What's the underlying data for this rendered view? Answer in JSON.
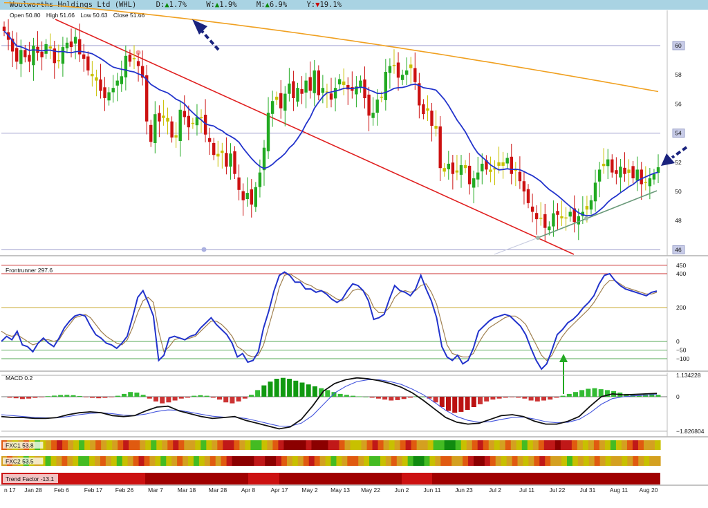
{
  "header": {
    "title": "Woolworths Holdings Ltd (WHL)",
    "changes": [
      {
        "label": "D:",
        "dir": "up",
        "value": "1.7%",
        "color": "#0a8a0a"
      },
      {
        "label": "W:",
        "dir": "up",
        "value": "1.9%",
        "color": "#0a8a0a"
      },
      {
        "label": "M:",
        "dir": "up",
        "value": "6.9%",
        "color": "#0a8a0a"
      },
      {
        "label": "Y:",
        "dir": "down",
        "value": "19.1%",
        "color": "#cc0000"
      }
    ]
  },
  "ohlc": {
    "open": "Open 50.80",
    "high": "High 51.66",
    "low": "Low 50.63",
    "close": "Close 51.66"
  },
  "panels": {
    "frontrunner_label": "Frontrunner 297.6",
    "macd_label": "MACD 0.2",
    "fxc1_label": "FXC1 53.8",
    "fxc2_label": "FXC2 53.5",
    "trend_label": "Trend Factor -13.1"
  },
  "colors": {
    "up_candle": "#22aa22",
    "down_candle": "#cc1111",
    "neutral_candle": "#c8c000",
    "ma_short": "#2233cc",
    "ma_long": "#f0a020",
    "trendline": "#e02020",
    "support": "#6a9a7a"
  },
  "chart_data": [
    {
      "type": "candlestick",
      "name": "price",
      "yticks": [
        46,
        48,
        50,
        52,
        54,
        56,
        58,
        60
      ],
      "ylim": [
        45.6,
        62.8
      ],
      "grid": "horizontal lines at 46, 54, 60",
      "close_series": [
        61.0,
        60.4,
        59.6,
        58.9,
        59.7,
        59.2,
        58.9,
        60.0,
        59.5,
        59.2,
        60.1,
        59.8,
        58.8,
        59.0,
        59.9,
        60.2,
        59.9,
        60.6,
        59.4,
        59.1,
        58.3,
        57.9,
        57.6,
        56.9,
        56.4,
        56.8,
        57.1,
        57.6,
        57.9,
        59.3,
        58.9,
        59.1,
        58.6,
        57.8,
        54.8,
        53.4,
        55.3,
        54.8,
        55.2,
        54.8,
        53.7,
        53.7,
        55.6,
        55.1,
        54.4,
        54.7,
        55.1,
        55.1,
        53.9,
        53.4,
        52.5,
        52.4,
        52.8,
        51.7,
        52.6,
        51.2,
        50.1,
        49.4,
        49.9,
        49.1,
        50.3,
        51.3,
        53.0,
        55.4,
        56.2,
        56.5,
        55.7,
        56.7,
        57.4,
        56.4,
        57.1,
        56.7,
        57.6,
        56.9,
        58.3,
        56.6,
        57.1,
        56.8,
        56.3,
        57.1,
        57.7,
        57.3,
        57.0,
        56.9,
        57.2,
        57.6,
        56.4,
        55.2,
        55.4,
        56.3,
        56.5,
        58.2,
        58.6,
        58.6,
        57.8,
        58.0,
        58.3,
        58.7,
        57.5,
        55.9,
        55.3,
        55.7,
        54.5,
        54.3,
        51.6,
        51.6,
        51.9,
        51.2,
        51.3,
        51.8,
        51.6,
        50.5,
        50.9,
        51.3,
        51.9,
        51.5,
        51.5,
        51.6,
        52.0,
        52.0,
        52.3,
        51.2,
        51.5,
        50.7,
        50.0,
        49.2,
        48.6,
        48.1,
        48.2,
        47.5,
        47.6,
        48.5,
        48.4,
        48.3,
        48.2,
        48.6,
        47.9,
        48.3,
        48.6,
        49.0,
        49.4,
        50.6,
        51.5,
        51.9,
        52.2,
        51.3,
        51.2,
        51.7,
        51.2,
        51.5,
        50.9,
        51.5,
        50.5,
        50.6,
        50.9,
        51.2,
        51.66
      ],
      "ma_short_endpoints": [
        {
          "label": "start",
          "value": 62.0
        },
        {
          "label": "end",
          "value": 50.4
        }
      ],
      "ma_long_endpoints": [
        {
          "label": "start",
          "value": 63.0
        },
        {
          "label": "end",
          "value": 56.6
        }
      ],
      "trendline_endpoints": [
        {
          "label": "start",
          "value": 62.2
        },
        {
          "label": "end",
          "value": 45.8
        }
      ],
      "support_endpoints": [
        {
          "label": "Jul 11",
          "value": 46.8
        },
        {
          "label": "Aug 20",
          "value": 50.1
        }
      ]
    },
    {
      "type": "line",
      "name": "Frontrunner",
      "yticks": [
        -100,
        -50,
        0,
        200,
        400,
        450
      ],
      "ylim": [
        -170,
        510
      ],
      "series": [
        {
          "color": "#2233cc",
          "values": [
            0,
            30,
            10,
            60,
            -20,
            -30,
            -60,
            -10,
            20,
            -10,
            -30,
            20,
            80,
            120,
            150,
            160,
            150,
            90,
            40,
            20,
            -10,
            -20,
            -40,
            -10,
            30,
            140,
            260,
            300,
            230,
            150,
            -110,
            -80,
            20,
            30,
            20,
            10,
            30,
            40,
            80,
            110,
            140,
            100,
            70,
            40,
            -10,
            -90,
            -70,
            -120,
            -110,
            -60,
            80,
            180,
            300,
            390,
            410,
            390,
            350,
            350,
            310,
            310,
            290,
            300,
            280,
            250,
            230,
            250,
            300,
            340,
            330,
            300,
            240,
            130,
            140,
            160,
            250,
            330,
            300,
            290,
            270,
            310,
            390,
            310,
            240,
            140,
            -30,
            -90,
            -110,
            -80,
            -130,
            -110,
            -40,
            60,
            90,
            120,
            140,
            150,
            160,
            150,
            120,
            90,
            40,
            -40,
            -110,
            -160,
            -130,
            -50,
            40,
            70,
            110,
            130,
            160,
            200,
            230,
            270,
            340,
            390,
            400,
            360,
            330,
            310,
            300,
            290,
            280,
            270,
            290,
            297.6
          ]
        },
        {
          "color": "#a08050",
          "values": [
            60,
            40,
            30,
            40,
            20,
            0,
            -20,
            -10,
            10,
            10,
            0,
            10,
            60,
            100,
            140,
            150,
            160,
            140,
            100,
            60,
            30,
            10,
            -10,
            -20,
            10,
            80,
            170,
            240,
            260,
            230,
            60,
            -60,
            -30,
            10,
            20,
            10,
            20,
            30,
            60,
            90,
            120,
            120,
            100,
            70,
            30,
            -30,
            -50,
            -80,
            -90,
            -80,
            -20,
            90,
            200,
            320,
            390,
            400,
            380,
            360,
            340,
            330,
            310,
            300,
            290,
            270,
            250,
            240,
            260,
            300,
            310,
            300,
            270,
            200,
            170,
            170,
            200,
            260,
            290,
            300,
            290,
            300,
            330,
            340,
            290,
            220,
            100,
            -20,
            -70,
            -80,
            -90,
            -90,
            -70,
            -10,
            40,
            80,
            100,
            120,
            140,
            150,
            150,
            130,
            100,
            40,
            -20,
            -80,
            -110,
            -80,
            -20,
            30,
            70,
            100,
            130,
            160,
            190,
            230,
            280,
            330,
            360,
            360,
            340,
            320,
            310,
            300,
            290,
            280,
            280,
            290
          ]
        }
      ],
      "hlines": [
        450,
        400,
        200,
        0,
        -50,
        -100
      ]
    },
    {
      "type": "line",
      "name": "MACD",
      "yticks": [
        -1.826804,
        0,
        1.134228
      ],
      "ylim": [
        -1.9,
        1.2
      ],
      "histogram": [
        -0.05,
        -0.08,
        -0.12,
        -0.1,
        -0.06,
        -0.02,
        0.03,
        0.06,
        0.09,
        0.1,
        0.08,
        0.04,
        -0.02,
        -0.06,
        -0.08,
        -0.06,
        -0.03,
        0.05,
        0.15,
        0.25,
        0.22,
        0.1,
        -0.1,
        -0.25,
        -0.35,
        -0.3,
        -0.2,
        -0.1,
        -0.05,
        0.05,
        0.08,
        0.05,
        -0.05,
        -0.15,
        -0.3,
        -0.35,
        -0.25,
        -0.1,
        0.1,
        0.35,
        0.6,
        0.8,
        0.95,
        1.0,
        0.95,
        0.85,
        0.75,
        0.65,
        0.55,
        0.45,
        0.35,
        0.25,
        0.15,
        0.1,
        0.05,
        0.02,
        0.0,
        -0.05,
        -0.1,
        -0.15,
        -0.2,
        -0.18,
        -0.12,
        -0.05,
        0.02,
        0.0,
        -0.1,
        -0.3,
        -0.55,
        -0.75,
        -0.85,
        -0.8,
        -0.7,
        -0.55,
        -0.4,
        -0.25,
        -0.15,
        -0.1,
        -0.05,
        -0.02,
        -0.05,
        -0.1,
        -0.2,
        -0.25,
        -0.2,
        -0.15,
        -0.05,
        0.05,
        0.15,
        0.25,
        0.35,
        0.42,
        0.45,
        0.4,
        0.35,
        0.3,
        0.22,
        0.15,
        0.1,
        0.08,
        0.12,
        0.15,
        0.1
      ],
      "macd_line": [
        -1.05,
        -1.1,
        -1.1,
        -1.15,
        -1.15,
        -1.1,
        -0.95,
        -0.85,
        -0.8,
        -0.85,
        -1.0,
        -1.05,
        -1.0,
        -0.75,
        -0.55,
        -0.5,
        -0.75,
        -0.9,
        -1.05,
        -1.15,
        -1.1,
        -1.05,
        -1.25,
        -1.4,
        -1.55,
        -1.7,
        -1.6,
        -1.2,
        -0.5,
        0.3,
        0.7,
        0.9,
        1.0,
        0.95,
        0.85,
        0.7,
        0.5,
        0.2,
        -0.2,
        -0.65,
        -1.1,
        -1.35,
        -1.45,
        -1.4,
        -1.2,
        -1.0,
        -0.95,
        -1.05,
        -1.3,
        -1.45,
        -1.45,
        -1.3,
        -1.05,
        -0.5,
        0.0,
        0.15,
        0.1,
        0.12,
        0.15,
        0.18
      ],
      "signal_line": [
        -0.95,
        -1.0,
        -1.05,
        -1.1,
        -1.12,
        -1.12,
        -1.05,
        -0.95,
        -0.88,
        -0.85,
        -0.9,
        -0.97,
        -1.0,
        -0.92,
        -0.78,
        -0.7,
        -0.72,
        -0.82,
        -0.93,
        -1.03,
        -1.08,
        -1.08,
        -1.15,
        -1.28,
        -1.42,
        -1.55,
        -1.56,
        -1.4,
        -1.0,
        -0.4,
        0.2,
        0.55,
        0.8,
        0.9,
        0.9,
        0.8,
        0.65,
        0.4,
        0.1,
        -0.3,
        -0.72,
        -1.05,
        -1.25,
        -1.35,
        -1.32,
        -1.2,
        -1.1,
        -1.08,
        -1.18,
        -1.32,
        -1.38,
        -1.35,
        -1.2,
        -0.85,
        -0.4,
        -0.1,
        0.0,
        0.05,
        0.08,
        0.12
      ]
    },
    {
      "type": "heatmap",
      "name": "FXC1",
      "cells": [
        2,
        3,
        4,
        3,
        2,
        4,
        5,
        4,
        3,
        2,
        1,
        2,
        3,
        4,
        5,
        4,
        3,
        2,
        3,
        4,
        3,
        2,
        1,
        2,
        2,
        3,
        4,
        5,
        4,
        3,
        2,
        1,
        2,
        3,
        3,
        4,
        5,
        4,
        3,
        2,
        1,
        1,
        2,
        3,
        4,
        5,
        5,
        4,
        3,
        2,
        1,
        0,
        0,
        0,
        0,
        1,
        0,
        0,
        0,
        1,
        1,
        2,
        3,
        4,
        4,
        3,
        2,
        1,
        2,
        3,
        4,
        3,
        2,
        1,
        2,
        3,
        3,
        4,
        5,
        5,
        6,
        6,
        5,
        4,
        3,
        2,
        1,
        2,
        3,
        4,
        3,
        2,
        3,
        4,
        5,
        4,
        3,
        2,
        1,
        1,
        0,
        1,
        1,
        2,
        3,
        4,
        3,
        2,
        3,
        4,
        5,
        4,
        3,
        2,
        1,
        2,
        3,
        3,
        4
      ]
    },
    {
      "type": "heatmap",
      "name": "FXC2",
      "cells": [
        3,
        2,
        3,
        4,
        5,
        4,
        3,
        4,
        5,
        4,
        3,
        2,
        3,
        4,
        5,
        5,
        4,
        3,
        2,
        3,
        4,
        5,
        4,
        3,
        2,
        1,
        2,
        3,
        4,
        5,
        4,
        3,
        2,
        3,
        4,
        5,
        4,
        3,
        2,
        3,
        2,
        1,
        0,
        0,
        0,
        0,
        1,
        1,
        0,
        0,
        1,
        2,
        3,
        4,
        3,
        2,
        1,
        2,
        3,
        4,
        5,
        4,
        3,
        2,
        2,
        3,
        4,
        5,
        5,
        4,
        3,
        2,
        3,
        4,
        5,
        6,
        6,
        5,
        4,
        3,
        2,
        2,
        3,
        3,
        2,
        1,
        0,
        0,
        1,
        2,
        3,
        4,
        3,
        2,
        3,
        4,
        3,
        2,
        1,
        2,
        3,
        3,
        4,
        5,
        4,
        3,
        4,
        3,
        2,
        3,
        4,
        3,
        3,
        4,
        3,
        2,
        3,
        4,
        3,
        3
      ]
    },
    {
      "type": "heatmap",
      "name": "Trend Factor",
      "segments": [
        {
          "from": "Jan 17",
          "to": "Feb 26",
          "level": "red"
        },
        {
          "from": "Mar 7",
          "to": "Apr 8",
          "level": "dark-red"
        },
        {
          "from": "Apr 8",
          "to": "Apr 17",
          "level": "red"
        },
        {
          "from": "Apr 17",
          "to": "May 2",
          "level": "dark-red"
        },
        {
          "from": "May 2",
          "to": "Jun 2",
          "level": "dark-red"
        },
        {
          "from": "Jun 2",
          "to": "Jun 11",
          "level": "red"
        },
        {
          "from": "Jun 11",
          "to": "Aug 20",
          "level": "dark-red"
        }
      ]
    },
    {
      "type": "axis",
      "name": "x",
      "tick_labels": [
        "n 17",
        "Jan 28",
        "Feb 6",
        "Feb 17",
        "Feb 26",
        "Mar 7",
        "Mar 18",
        "Mar 28",
        "Apr 8",
        "Apr 17",
        "May 2",
        "May 13",
        "May 22",
        "Jun 2",
        "Jun 11",
        "Jun 23",
        "Jul 2",
        "Jul 11",
        "Jul 22",
        "Jul 31",
        "Aug 11",
        "Aug 20"
      ]
    }
  ]
}
